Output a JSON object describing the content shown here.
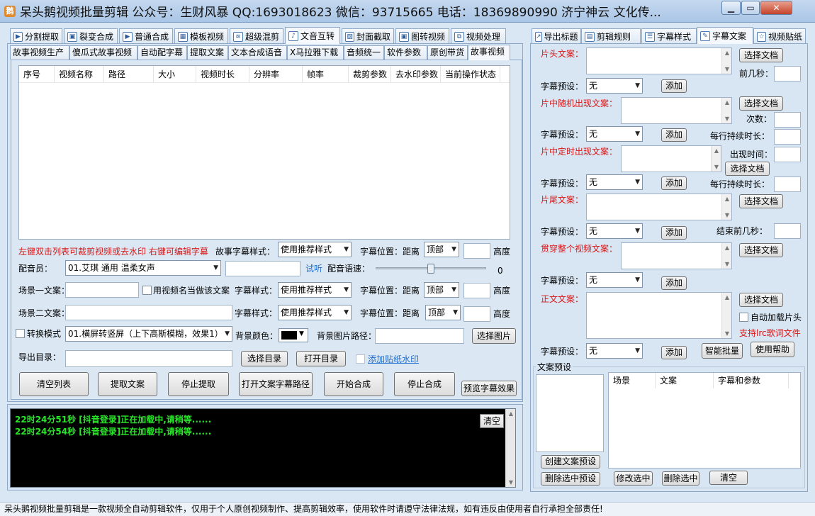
{
  "window": {
    "title": "呆头鹅视频批量剪辑 公众号：生财风暴 QQ:1693018623 微信：93715665 电话：18369890990 济宁神云 文化传...",
    "logo_glyph": "鹅",
    "min_glyph": "▁",
    "max_glyph": "▭",
    "close_glyph": "✕"
  },
  "main_tabs": [
    {
      "label": "分割提取",
      "icon": "split-icon",
      "glyph": "▶"
    },
    {
      "label": "裂变合成",
      "icon": "fission-icon",
      "glyph": "▣"
    },
    {
      "label": "普通合成",
      "icon": "play-icon",
      "glyph": "▶"
    },
    {
      "label": "模板视频",
      "icon": "template-icon",
      "glyph": "▦"
    },
    {
      "label": "超级混剪",
      "icon": "waveform-icon",
      "glyph": "≋"
    },
    {
      "label": "文音互转",
      "icon": "microphone-icon",
      "glyph": "♪"
    },
    {
      "label": "封面截取",
      "icon": "image-icon",
      "glyph": "▨"
    },
    {
      "label": "图转视频",
      "icon": "photo-video-icon",
      "glyph": "▣"
    },
    {
      "label": "视频处理",
      "icon": "video-process-icon",
      "glyph": "⧉"
    }
  ],
  "sub_tabs": [
    "故事视频生产",
    "傻瓜式故事视频",
    "自动配字幕",
    "提取文案",
    "文本合成语音",
    "X马拉雅下载",
    "音频统一",
    "软件参数",
    "原创带货",
    "故事视频"
  ],
  "table": {
    "columns": [
      "序号",
      "视频名称",
      "路径",
      "大小",
      "视频时长",
      "分辨率",
      "帧率",
      "裁剪参数",
      "去水印参数",
      "当前操作状态"
    ]
  },
  "form": {
    "hint_red": "左键双击列表可裁剪视频或去水印 右键可编辑字幕",
    "story_style_label": "故事字幕样式：",
    "story_style_value": "使用推荐样式",
    "sub_pos_label": "字幕位置：距离",
    "sub_pos_value": "顶部",
    "height_label": "高度",
    "voice_label": "配音员：",
    "voice_value": "01.艾琪 通用 温柔女声",
    "listen_link": "试听",
    "speed_label": "配音语速：",
    "speed_value": "0",
    "speed_fraction": 0.5,
    "scene1_label": "场景一文案：",
    "use_name_label": "用视频名当做该文案",
    "sub_style_label": "字幕样式：",
    "sub_style_value": "使用推荐样式",
    "scene2_label": "场景二文案：",
    "convert_label": "转换模式",
    "convert_value": "01.横屏转竖屏（上下高斯模糊，效果1）",
    "bg_color_label": "背景颜色：",
    "bg_color": "#000000",
    "bg_image_label": "背景图片路径：",
    "choose_image_btn": "选择图片",
    "export_label": "导出目录：",
    "choose_dir_btn": "选择目录",
    "open_dir_btn": "打开目录",
    "watermark_link": "添加贴纸水印"
  },
  "actions": {
    "clear_list": "清空列表",
    "extract": "提取文案",
    "stop_extract": "停止提取",
    "open_path": "打开文案字幕路径",
    "start": "开始合成",
    "stop": "停止合成",
    "preview": "预览字幕效果"
  },
  "log": {
    "lines": [
      "22时24分51秒 [抖音登录]正在加载中,请稍等......",
      "22时24分54秒 [抖音登录]正在加载中,请稍等......"
    ],
    "clear_btn": "清空"
  },
  "right_tabs": [
    {
      "label": "导出标题",
      "icon": "export-title-icon",
      "glyph": "↗"
    },
    {
      "label": "剪辑规则",
      "icon": "rule-icon",
      "glyph": "▤"
    },
    {
      "label": "字幕样式",
      "icon": "subtitle-style-icon",
      "glyph": "☰"
    },
    {
      "label": "字幕文案",
      "icon": "edit-doc-icon",
      "glyph": "✎"
    },
    {
      "label": "视频贴纸",
      "icon": "star-icon",
      "glyph": "☆"
    }
  ],
  "right": {
    "head_label": "片头文案：",
    "choose_doc": "选择文档",
    "first_sec_label": "前几秒：",
    "preset_label": "字幕预设：",
    "preset_value": "无",
    "add": "添加",
    "mid_random_label": "片中随机出现文案：",
    "times_label": "次数：",
    "per_line_label": "每行持续时长：",
    "mid_fixed_label": "片中定时出现文案：",
    "appear_time_label": "出现时间：",
    "tail_label": "片尾文案：",
    "end_sec_label": "结束前几秒：",
    "whole_label": "贯穿整个视频文案：",
    "body_label": "正文文案：",
    "auto_head_label": "自动加载片头",
    "lrc_note": "支持lrc歌词文件",
    "smart_batch": "智能批量",
    "help": "使用帮助",
    "preset_group": "文案预设",
    "preset_cols": [
      "场景",
      "文案",
      "字幕和参数"
    ],
    "create_preset": "创建文案预设",
    "delete_preset": "删除选中预设",
    "modify_selected": "修改选中",
    "delete_selected": "删除选中",
    "clear": "清空"
  },
  "status_text": "呆头鹅视频批量剪辑是一款视频全自动剪辑软件，仅用于个人原创视频制作、提高剪辑效率，使用软件时请遵守法律法规，如有违反由使用者自行承担全部责任!"
}
